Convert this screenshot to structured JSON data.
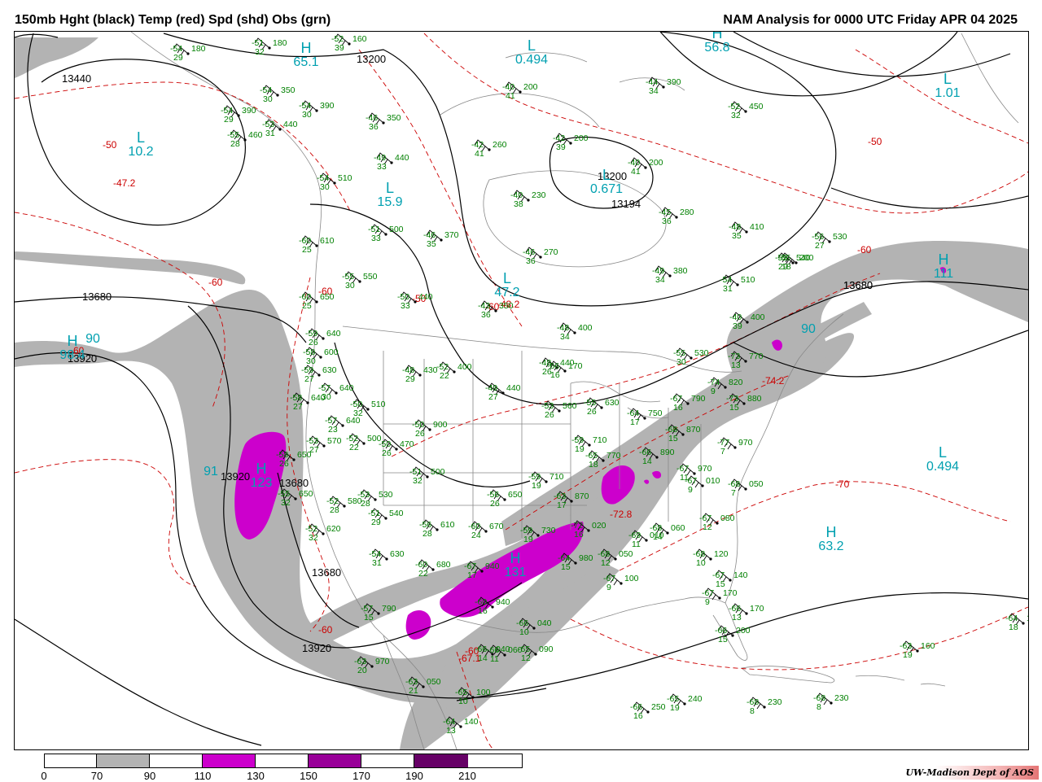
{
  "header": {
    "left_title": "150mb Hght (black) Temp (red) Spd (shd) Obs (grn)",
    "right_title": "NAM Analysis for 0000 UTC Friday  APR 04 2025"
  },
  "legend": {
    "ticks": [
      "0",
      "70",
      "90",
      "110",
      "130",
      "150",
      "170",
      "190",
      "210"
    ],
    "bins": [
      {
        "range": "0-70",
        "color": "#ffffff"
      },
      {
        "range": "70-90",
        "color": "#b3b3b3"
      },
      {
        "range": "90-110",
        "color": "#ffffff"
      },
      {
        "range": "110-130",
        "color": "#cc00cc"
      },
      {
        "range": "130-150",
        "color": "#ffffff"
      },
      {
        "range": "150-170",
        "color": "#990099"
      },
      {
        "range": "170-190",
        "color": "#ffffff"
      },
      {
        "range": "190-210",
        "color": "#660066"
      }
    ]
  },
  "credit": "UW-Madison   Dept of AOS",
  "colors": {
    "height_contour": "#000000",
    "temperature_contour": "#cc0000",
    "speed_label": "#00a0b0",
    "observation": "#008000",
    "borders": "#888888"
  },
  "height_labels": [
    "13440",
    "13200",
    "13680",
    "13920",
    "13680",
    "13920",
    "13680",
    "13680",
    "13920",
    "13200",
    "13194",
    "13680"
  ],
  "temperature_labels": [
    "-50",
    "-47.2",
    "-60",
    "-60",
    "-50",
    "-60",
    "-43.2",
    "-60",
    "-60",
    "-50",
    "-60",
    "-70",
    "-74.2",
    "-72.8",
    "-67.1",
    "-60"
  ],
  "pressure_centers": [
    {
      "letter": "H",
      "value": "65.1"
    },
    {
      "letter": "L",
      "value": "10.2"
    },
    {
      "letter": "L",
      "value": "15.9"
    },
    {
      "letter": "H",
      "value": "98.4"
    },
    {
      "letter": "",
      "value": "90"
    },
    {
      "letter": "H",
      "value": "123"
    },
    {
      "letter": "",
      "value": "91"
    },
    {
      "letter": "L",
      "value": "0.494"
    },
    {
      "letter": "L",
      "value": "0.671"
    },
    {
      "letter": "H",
      "value": "56.8"
    },
    {
      "letter": "L",
      "value": "1.01"
    },
    {
      "letter": "H",
      "value": "111"
    },
    {
      "letter": "",
      "value": "90"
    },
    {
      "letter": "L",
      "value": "0.494"
    },
    {
      "letter": "H",
      "value": "63.2"
    },
    {
      "letter": "H",
      "value": "131"
    },
    {
      "letter": "L",
      "value": "47.2"
    }
  ],
  "station_observations": [
    {
      "temp": "-54",
      "hgt": "180",
      "dew": "29"
    },
    {
      "temp": "-51",
      "hgt": "180",
      "dew": "32"
    },
    {
      "temp": "-52",
      "hgt": "160",
      "dew": "39"
    },
    {
      "temp": "-54",
      "hgt": "350",
      "dew": "30"
    },
    {
      "temp": "-54",
      "hgt": "390",
      "dew": "30"
    },
    {
      "temp": "-54",
      "hgt": "390",
      "dew": "29"
    },
    {
      "temp": "-53",
      "hgt": "440",
      "dew": "31"
    },
    {
      "temp": "-55",
      "hgt": "460",
      "dew": "28"
    },
    {
      "temp": "-46",
      "hgt": "350",
      "dew": "36"
    },
    {
      "temp": "-40",
      "hgt": "200",
      "dew": "41"
    },
    {
      "temp": "-42",
      "hgt": "260",
      "dew": "41"
    },
    {
      "temp": "-42",
      "hgt": "200",
      "dew": "39"
    },
    {
      "temp": "-44",
      "hgt": "390",
      "dew": "34"
    },
    {
      "temp": "-52",
      "hgt": "450",
      "dew": "32"
    },
    {
      "temp": "-49",
      "hgt": "440",
      "dew": "33"
    },
    {
      "temp": "-54",
      "hgt": "510",
      "dew": "30"
    },
    {
      "temp": "-40",
      "hgt": "200",
      "dew": "41"
    },
    {
      "temp": "-40",
      "hgt": "230",
      "dew": "38"
    },
    {
      "temp": "-45",
      "hgt": "280",
      "dew": "36"
    },
    {
      "temp": "-51",
      "hgt": "500",
      "dew": "33"
    },
    {
      "temp": "-46",
      "hgt": "370",
      "dew": "35"
    },
    {
      "temp": "-48",
      "hgt": "410",
      "dew": "35"
    },
    {
      "temp": "-56",
      "hgt": "530",
      "dew": "27"
    },
    {
      "temp": "-60",
      "hgt": "610",
      "dew": "25"
    },
    {
      "temp": "-46",
      "hgt": "270",
      "dew": "36"
    },
    {
      "temp": "-55",
      "hgt": "540",
      "dew": "29"
    },
    {
      "temp": "-49",
      "hgt": "380",
      "dew": "34"
    },
    {
      "temp": "-54",
      "hgt": "510",
      "dew": "31"
    },
    {
      "temp": "-55",
      "hgt": "550",
      "dew": "30"
    },
    {
      "temp": "-50",
      "hgt": "440",
      "dew": "33"
    },
    {
      "temp": "-60",
      "hgt": "650",
      "dew": "25"
    },
    {
      "temp": "-59",
      "hgt": "640",
      "dew": "26"
    },
    {
      "temp": "-43",
      "hgt": "350",
      "dew": "36"
    },
    {
      "temp": "-48",
      "hgt": "400",
      "dew": "34"
    },
    {
      "temp": "-58",
      "hgt": "600",
      "dew": "30"
    },
    {
      "temp": "-59",
      "hgt": "630",
      "dew": "27"
    },
    {
      "temp": "-48",
      "hgt": "430",
      "dew": "29"
    },
    {
      "temp": "-52",
      "hgt": "400",
      "dew": "22"
    },
    {
      "temp": "-48",
      "hgt": "440",
      "dew": "26"
    },
    {
      "temp": "-57",
      "hgt": "640",
      "dew": "30"
    },
    {
      "temp": "-49",
      "hgt": "440",
      "dew": "27"
    },
    {
      "temp": "-73",
      "hgt": "770",
      "dew": "13"
    },
    {
      "temp": "-58",
      "hgt": "640",
      "dew": "27"
    },
    {
      "temp": "-50",
      "hgt": "510",
      "dew": "32"
    },
    {
      "temp": "-57",
      "hgt": "640",
      "dew": "23"
    },
    {
      "temp": "-74",
      "hgt": "820",
      "dew": "9"
    },
    {
      "temp": "-53",
      "hgt": "560",
      "dew": "26"
    },
    {
      "temp": "-55",
      "hgt": "630",
      "dew": "26"
    },
    {
      "temp": "-67",
      "hgt": "790",
      "dew": "16"
    },
    {
      "temp": "-73",
      "hgt": "880",
      "dew": "15"
    },
    {
      "temp": "-53",
      "hgt": "570",
      "dew": "27"
    },
    {
      "temp": "-52",
      "hgt": "500",
      "dew": "22"
    },
    {
      "temp": "-50",
      "hgt": "900",
      "dew": "26"
    },
    {
      "temp": "-64",
      "hgt": "750",
      "dew": "17"
    },
    {
      "temp": "-68",
      "hgt": "870",
      "dew": "15"
    },
    {
      "temp": "-77",
      "hgt": "970",
      "dew": "7"
    },
    {
      "temp": "-58",
      "hgt": "650",
      "dew": "26"
    },
    {
      "temp": "-50",
      "hgt": "470",
      "dew": "26"
    },
    {
      "temp": "-59",
      "hgt": "710",
      "dew": "19"
    },
    {
      "temp": "-66",
      "hgt": "890",
      "dew": "14"
    },
    {
      "temp": "-51",
      "hgt": "500",
      "dew": "32"
    },
    {
      "temp": "-65",
      "hgt": "770",
      "dew": "18"
    },
    {
      "temp": "-67",
      "hgt": "970",
      "dew": "11"
    },
    {
      "temp": "-67",
      "hgt": "010",
      "dew": "9"
    },
    {
      "temp": "-55",
      "hgt": "650",
      "dew": "32"
    },
    {
      "temp": "-52",
      "hgt": "580",
      "dew": "28"
    },
    {
      "temp": "-53",
      "hgt": "530",
      "dew": "28"
    },
    {
      "temp": "-56",
      "hgt": "650",
      "dew": "26"
    },
    {
      "temp": "-59",
      "hgt": "710",
      "dew": "19"
    },
    {
      "temp": "-63",
      "hgt": "870",
      "dew": "17"
    },
    {
      "temp": "-68",
      "hgt": "050",
      "dew": "7"
    },
    {
      "temp": "-51",
      "hgt": "540",
      "dew": "29"
    },
    {
      "temp": "-52",
      "hgt": "620",
      "dew": "32"
    },
    {
      "temp": "-56",
      "hgt": "610",
      "dew": "28"
    },
    {
      "temp": "-60",
      "hgt": "670",
      "dew": "24"
    },
    {
      "temp": "-59",
      "hgt": "730",
      "dew": "19"
    },
    {
      "temp": "-72",
      "hgt": "020",
      "dew": "16"
    },
    {
      "temp": "-69",
      "hgt": "010",
      "dew": "11"
    },
    {
      "temp": "-68",
      "hgt": "060",
      "dew": "14"
    },
    {
      "temp": "-67",
      "hgt": "080",
      "dew": "12"
    },
    {
      "temp": "-54",
      "hgt": "630",
      "dew": "31"
    },
    {
      "temp": "-60",
      "hgt": "680",
      "dew": "22"
    },
    {
      "temp": "-67",
      "hgt": "940",
      "dew": "17"
    },
    {
      "temp": "-64",
      "hgt": "980",
      "dew": "15"
    },
    {
      "temp": "-68",
      "hgt": "050",
      "dew": "12"
    },
    {
      "temp": "-68",
      "hgt": "120",
      "dew": "10"
    },
    {
      "temp": "-57",
      "hgt": "790",
      "dew": "15"
    },
    {
      "temp": "-60",
      "hgt": "940",
      "dew": "16"
    },
    {
      "temp": "-66",
      "hgt": "040",
      "dew": "10"
    },
    {
      "temp": "-67",
      "hgt": "100",
      "dew": "9"
    },
    {
      "temp": "-67",
      "hgt": "140",
      "dew": "15"
    },
    {
      "temp": "-67",
      "hgt": "170",
      "dew": "9"
    },
    {
      "temp": "-63",
      "hgt": "970",
      "dew": "20"
    },
    {
      "temp": "-66",
      "hgt": "040",
      "dew": "14"
    },
    {
      "temp": "-66",
      "hgt": "170",
      "dew": "13"
    },
    {
      "temp": "-66",
      "hgt": "200",
      "dew": "15"
    },
    {
      "temp": "-66",
      "hgt": "060",
      "dew": "11"
    },
    {
      "temp": "-65",
      "hgt": "090",
      "dew": "12"
    },
    {
      "temp": "-63",
      "hgt": "050",
      "dew": "21"
    },
    {
      "temp": "-65",
      "hgt": "100",
      "dew": "10"
    },
    {
      "temp": "-64",
      "hgt": "140",
      "dew": "13"
    },
    {
      "temp": "-66",
      "hgt": "250",
      "dew": "16"
    },
    {
      "temp": "-65",
      "hgt": "240",
      "dew": "19"
    },
    {
      "temp": "-68",
      "hgt": "230",
      "dew": "8"
    },
    {
      "temp": "-68",
      "hgt": "230",
      "dew": "8"
    },
    {
      "temp": "-64",
      "hgt": "140",
      "dew": "18"
    },
    {
      "temp": "-63",
      "hgt": "160",
      "dew": "19"
    },
    {
      "temp": "-66",
      "hgt": "170",
      "dew": "16"
    },
    {
      "temp": "-65",
      "hgt": "200",
      "dew": "18"
    },
    {
      "temp": "-40",
      "hgt": "400",
      "dew": "39"
    },
    {
      "temp": "-55",
      "hgt": "530",
      "dew": "30"
    },
    {
      "temp": "-58",
      "hgt": "600",
      "dew": "30"
    },
    {
      "temp": "-67",
      "hgt": "640",
      "dew": "28"
    }
  ]
}
